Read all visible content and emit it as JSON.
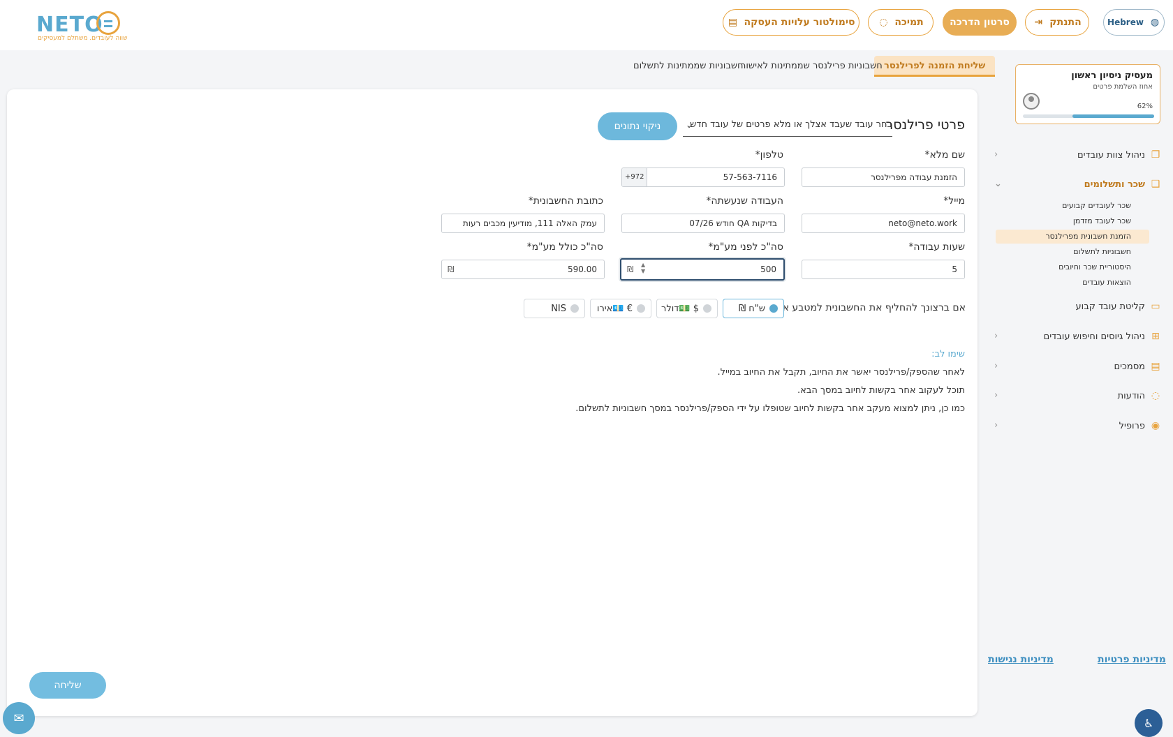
{
  "header": {
    "logo_text": "NETO",
    "logo_tagline": "שווה לעובדים. משתלם למעסיקים",
    "cost_simulator": "סימולטור עלויות העסקה",
    "support": "תמיכה",
    "tutorial": "סרטון הדרכה",
    "logout": "התנתק",
    "language": "Hebrew"
  },
  "profile": {
    "name": "מעסיק ניסיון ראשון",
    "subtitle": "אחוז השלמת פרטים",
    "percent_label": "62%",
    "percent_value": 62
  },
  "sidebar": {
    "items": [
      {
        "label": "ניהול צוות עובדים",
        "icon": "document-icon"
      },
      {
        "label": "שכר ותשלומים",
        "icon": "payments-icon"
      },
      {
        "label": "קליטת עובד קבוע",
        "icon": "briefcase-icon"
      },
      {
        "label": "ניהול גיוסים וחיפוש עובדים",
        "icon": "grid-plus-icon"
      },
      {
        "label": "מסמכים",
        "icon": "files-icon"
      },
      {
        "label": "הודעות",
        "icon": "message-icon"
      },
      {
        "label": "פרופיל",
        "icon": "user-circle-icon"
      }
    ],
    "subitems": [
      "שכר לעובדים קבועים",
      "שכר לעובד מזדמן",
      "הזמנת חשבונית מפרילנסר",
      "חשבוניות לתשלום",
      "היסטוריית שכר וחיובים",
      "הוצאות עובדים"
    ],
    "privacy_policy": "מדיניות פרטיות",
    "accessibility_policy": "מדיניות נגישות"
  },
  "tabs": [
    {
      "label": "שליחת הזמנה לפרילנסר",
      "active": true
    },
    {
      "label": "חשבוניות פרילנסר שממתינות לאישור",
      "active": false
    },
    {
      "label": "חשבוניות שממתינות לתשלום",
      "active": false
    }
  ],
  "form": {
    "section_title": "פרטי פרילנסר",
    "picker_placeholder": "בחר עובד שעבד אצלך או מלא פרטים של עובד חדש",
    "clear_button": "ניקוי נתונים",
    "full_name_label": "שם מלא*",
    "full_name_value": "הזמנת עבודה מפרילנסר",
    "phone_label": "טלפון*",
    "phone_prefix": "+972",
    "phone_value": "57-563-7116",
    "email_label": "מייל*",
    "email_value": "neto@neto.work",
    "work_done_label": "העבודה שנעשתה*",
    "work_done_value": "בדיקות QA חודש 07/26",
    "invoice_address_label": "כתובת החשבונית*",
    "invoice_address_value": "עמק האלה 111, מודיעין מכבים רעות",
    "work_hours_label": "שעות עבודה*",
    "work_hours_value": "5",
    "total_before_vat_label": "סה\"כ לפני מע\"מ*",
    "total_before_vat_value": "500",
    "total_incl_vat_label": "סה\"כ כולל מע\"מ*",
    "total_incl_vat_value": "590.00",
    "currency_symbol": "₪"
  },
  "currency": {
    "label": "אם ברצונך להחליף את החשבונית למטבע אחר.",
    "options": [
      {
        "label": "ש\"ח ₪",
        "selected": true
      },
      {
        "label": "$ 💵דולר",
        "selected": false
      },
      {
        "label": "€ 💶אירו",
        "selected": false
      },
      {
        "label": "NIS",
        "selected": false
      }
    ]
  },
  "note": {
    "title": "שימו לב:",
    "lines": [
      "לאחר שהספק/פרילנסר יאשר את החיוב, תקבל את החיוב במייל.",
      "תוכל לעקוב אחר בקשות לחיוב במסך הבא.",
      "כמו כן, ניתן למצוא מעקב אחר בקשות לחיוב שטופלו על ידי הספק/פרילנסר במסך חשבוניות לתשלום."
    ]
  },
  "send_button": "שליחה",
  "colors": {
    "accent_orange": "#e8a33d",
    "accent_blue": "#5aa9cf"
  }
}
